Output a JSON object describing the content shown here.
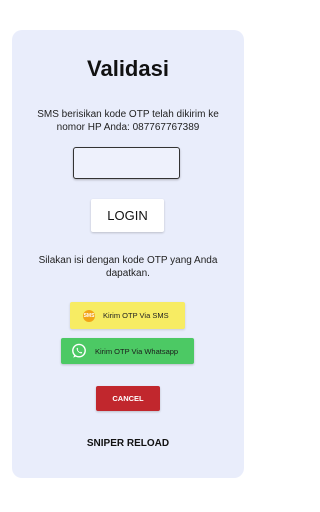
{
  "screen": {
    "title": "Validasi",
    "description": "SMS berisikan kode OTP telah dikirim ke nomor HP Anda: 087767767389",
    "otp_input": {
      "value": "",
      "placeholder": ""
    },
    "login_label": "LOGIN",
    "hint": "Silakan isi dengan kode OTP yang Anda dapatkan.",
    "sms_button": {
      "label": "Kirim OTP Via SMS",
      "icon": "sms-icon",
      "icon_text": "SMS",
      "color": "#f7ec63"
    },
    "whatsapp_button": {
      "label": "Kirim OTP Via Whatsapp",
      "icon": "whatsapp-icon",
      "color": "#4cc964"
    },
    "cancel_label": "CANCEL",
    "cancel_color": "#c1272d",
    "brand": "SNIPER RELOAD",
    "card_color": "#e9edfb"
  }
}
